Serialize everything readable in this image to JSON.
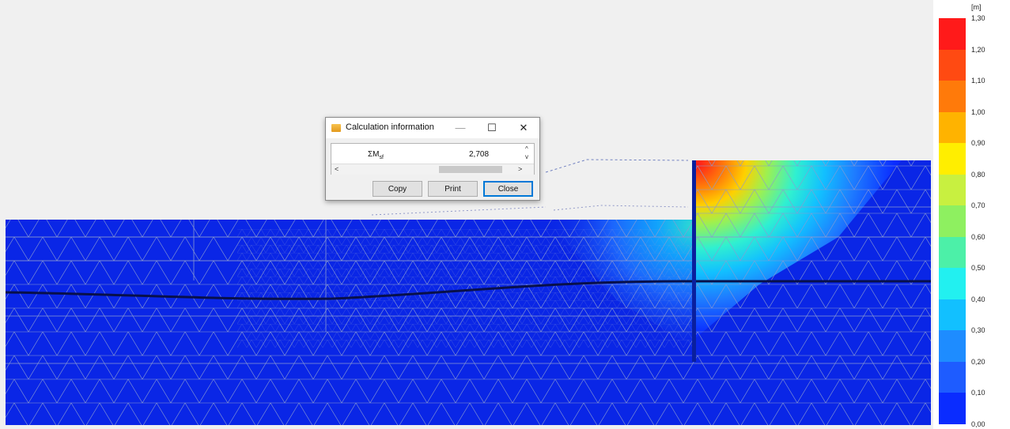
{
  "dialog": {
    "title": "Calculation information",
    "minimize_glyph": "—",
    "maximize_glyph": "☐",
    "close_glyph": "✕",
    "result_row": {
      "symbol": "ΣM",
      "subscript": "sf",
      "value": "2,708"
    },
    "scroll_up_glyph": "^",
    "scroll_down_glyph": "v",
    "scroll_left_glyph": "<",
    "scroll_right_glyph": ">",
    "buttons": {
      "copy": "Copy",
      "print": "Print",
      "close": "Close"
    }
  },
  "legend": {
    "unit": "[m]",
    "ticks": [
      "1,30",
      "1,20",
      "1,10",
      "1,00",
      "0,90",
      "0,80",
      "0,70",
      "0,60",
      "0,50",
      "0,40",
      "0,30",
      "0,20",
      "0,10",
      "0,00"
    ],
    "colors": [
      "#ff1a1a",
      "#ff4a12",
      "#ff7a0a",
      "#ffb300",
      "#ffee00",
      "#c8f040",
      "#8ef060",
      "#4cf0a8",
      "#22f0f0",
      "#12c0ff",
      "#1e8cff",
      "#1e5cff",
      "#0a2cff"
    ]
  },
  "model": {
    "soil_color": "#0a26e6",
    "mesh_color": "#8a9ad0",
    "wall_color": "#0a1f9e",
    "water_table_color": "#08104a"
  }
}
